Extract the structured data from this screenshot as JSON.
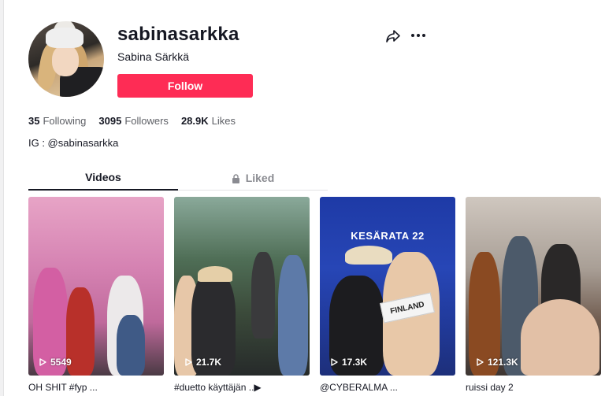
{
  "profile": {
    "username": "sabinasarkka",
    "nickname": "Sabina Särkkä",
    "follow_label": "Follow",
    "bio": "IG : @sabinasarkka"
  },
  "stats": [
    {
      "value": "35",
      "label": "Following"
    },
    {
      "value": "3095",
      "label": "Followers"
    },
    {
      "value": "28.9K",
      "label": "Likes"
    }
  ],
  "tabs": [
    {
      "label": "Videos",
      "active": true
    },
    {
      "label": "Liked",
      "active": false,
      "icon": "lock-icon"
    }
  ],
  "videos": [
    {
      "views": "5549",
      "caption": "OH SHIT #fyp ...",
      "overlay": ""
    },
    {
      "views": "21.7K",
      "caption": "#duetto käyttäjän ..▶",
      "overlay": ""
    },
    {
      "views": "17.3K",
      "caption": "@CYBERALMA ...",
      "overlay": "KESÄRATA 22",
      "sign": "FINLAND"
    },
    {
      "views": "121.3K",
      "caption": "ruissi day 2",
      "overlay": ""
    }
  ],
  "icons": {
    "share": "share-arrow-icon",
    "more": "more-dots-icon",
    "play": "play-icon"
  },
  "colors": {
    "accent": "#fe2c55",
    "text": "#161823",
    "muted": "#5e6066"
  }
}
